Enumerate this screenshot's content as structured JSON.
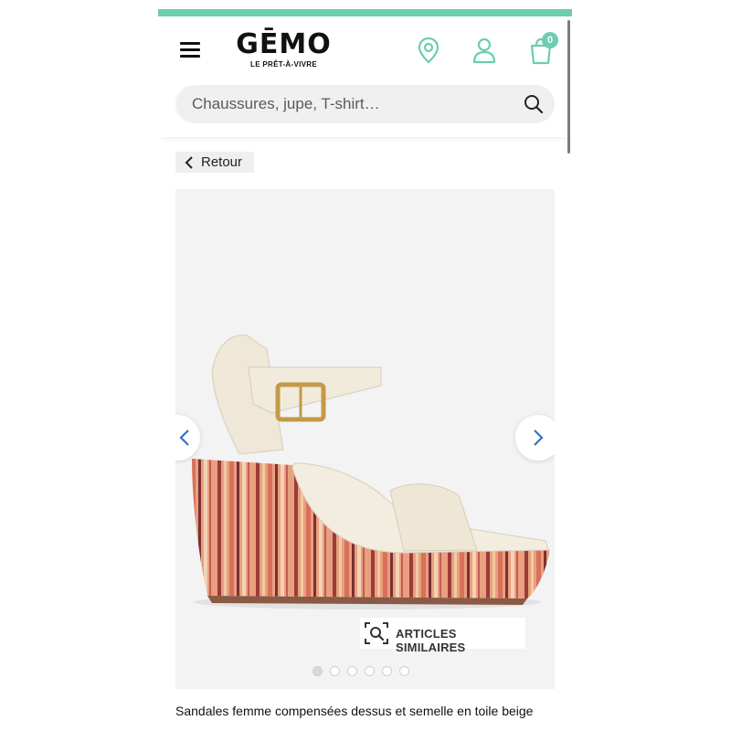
{
  "brand": {
    "name": "GĒMO",
    "tagline": "LE PRÊT-À-VIVRE",
    "accent_color": "#6ccdb1"
  },
  "header": {
    "menu_icon": "hamburger-menu-icon",
    "store_icon": "location-pin-icon",
    "account_icon": "user-icon",
    "cart_icon": "shopping-bag-icon",
    "cart_count": "0"
  },
  "search": {
    "placeholder": "Chaussures, jupe, T-shirt…",
    "icon": "search-icon"
  },
  "back_button": {
    "label": "Retour",
    "icon": "chevron-left-icon"
  },
  "gallery": {
    "prev_icon": "chevron-left-icon",
    "next_icon": "chevron-right-icon",
    "similar_label": "ARTICLES SIMILAIRES",
    "similar_icon": "visual-search-icon",
    "slide_count": 6,
    "active_slide": 1
  },
  "product": {
    "title": "Sandales femme compensées dessus et semelle en toile beige"
  }
}
